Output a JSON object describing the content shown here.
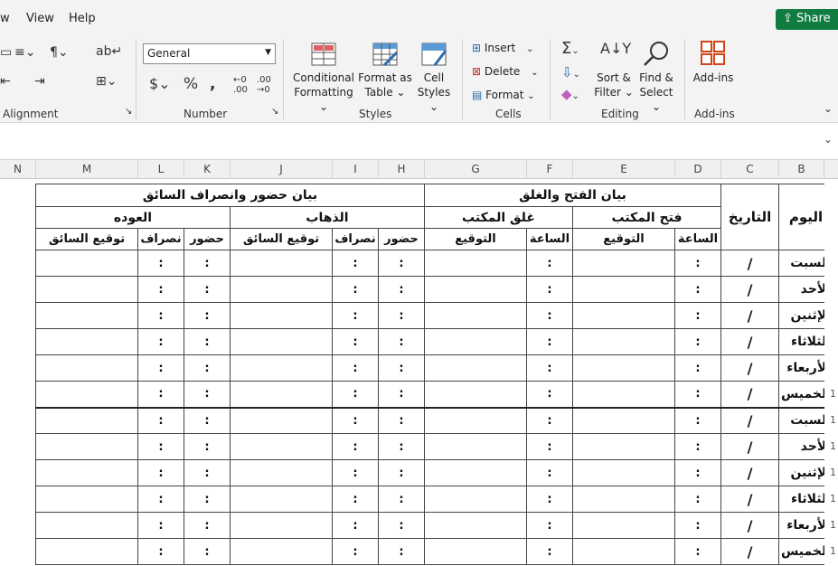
{
  "menu": [
    "w",
    "View",
    "Help"
  ],
  "share_label": "Share",
  "ribbon": {
    "groups": {
      "alignment": "Alignment",
      "number": "Number",
      "styles": "Styles",
      "cells": "Cells",
      "editing": "Editing",
      "addins": "Add-ins"
    },
    "number_format": "General",
    "conditional_formatting": [
      "Conditional",
      "Formatting"
    ],
    "format_as_table": [
      "Format as",
      "Table"
    ],
    "cell_styles": [
      "Cell",
      "Styles"
    ],
    "insert": "Insert",
    "delete": "Delete",
    "format": "Format",
    "sort_filter": [
      "Sort &",
      "Filter"
    ],
    "find_select": [
      "Find &",
      "Select"
    ],
    "addins_button": "Add-ins"
  },
  "columns": [
    "N",
    "M",
    "L",
    "K",
    "J",
    "I",
    "H",
    "G",
    "F",
    "E",
    "D",
    "C",
    "B"
  ],
  "sheet": {
    "title_right": "بيان الفتح والغلق",
    "title_left": "بيان حضور وانصراف السائق",
    "day_header": "اليوم",
    "date_header": "التاريخ",
    "open_office": "فتح المكتب",
    "close_office": "غلق المكتب",
    "going": "الذهاب",
    "return": "العوده",
    "time": "الساعة",
    "signature": "التوقيع",
    "attend": "حضور",
    "leave": "نصراف",
    "driver_sig": "توقيع السائق",
    "days": [
      "السبت",
      "الأحد",
      "الإثنين",
      "الثلاثاء",
      "الأربعاء",
      "الخميس",
      "السبت",
      "الأحد",
      "الإثنين",
      "الثلاثاء",
      "الأربعاء",
      "الخميس"
    ],
    "slash": "/",
    "colon": ":"
  },
  "row_numbers_partial": [
    "1",
    "1",
    "1",
    "1",
    "1",
    "1",
    "1"
  ]
}
